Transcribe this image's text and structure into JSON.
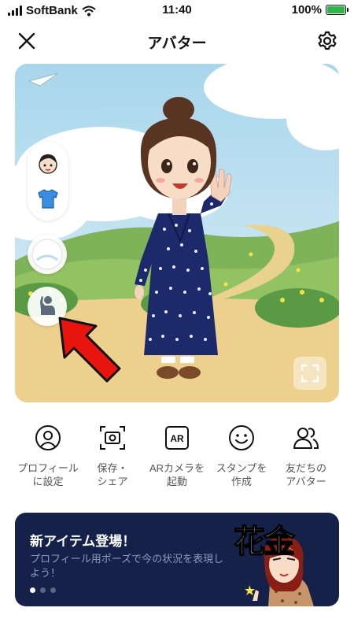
{
  "status": {
    "carrier": "SoftBank",
    "time": "11:40",
    "battery": "100%",
    "battery_level": 1.0
  },
  "header": {
    "title": "アバター"
  },
  "stage": {
    "side_items": [
      "face-icon",
      "shirt-icon"
    ],
    "buttons": [
      "background-icon",
      "pose-icon"
    ]
  },
  "actions": [
    {
      "label": "プロフィール\nに設定",
      "icon": "profile-icon"
    },
    {
      "label": "保存・\nシェア",
      "icon": "camera-icon"
    },
    {
      "label": "ARカメラを\n起動",
      "icon": "ar-icon",
      "badge": "AR"
    },
    {
      "label": "スタンプを\n作成",
      "icon": "smile-icon"
    },
    {
      "label": "友だちの\nアバター",
      "icon": "friends-icon"
    }
  ],
  "banner": {
    "title": "新アイテム登場！",
    "subtitle": "プロフィール用ポーズで今の状況を表現しよう！",
    "art_text": "花金",
    "page_count": 3,
    "active_page": 1
  },
  "colors": {
    "arrow": "#e8140e",
    "banner_bg": "#152148",
    "battery": "#2fb54a"
  }
}
